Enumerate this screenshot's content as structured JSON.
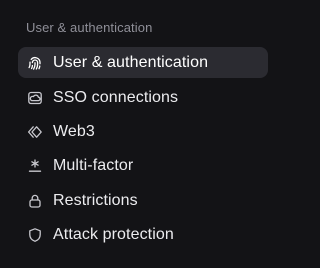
{
  "section": {
    "title": "User & authentication"
  },
  "items": [
    {
      "label": "User & authentication",
      "icon": "fingerprint-icon",
      "active": true
    },
    {
      "label": "SSO connections",
      "icon": "sso-cloud-icon",
      "active": false
    },
    {
      "label": "Web3",
      "icon": "web3-chevrons-icon",
      "active": false
    },
    {
      "label": "Multi-factor",
      "icon": "asterisk-icon",
      "active": false
    },
    {
      "label": "Restrictions",
      "icon": "lock-icon",
      "active": false
    },
    {
      "label": "Attack protection",
      "icon": "shield-icon",
      "active": false
    }
  ],
  "colors": {
    "background": "#131316",
    "active_background": "#2b2b31",
    "text": "#ececef",
    "section_title": "#8f8f98",
    "icon": "#c9c9cf"
  }
}
